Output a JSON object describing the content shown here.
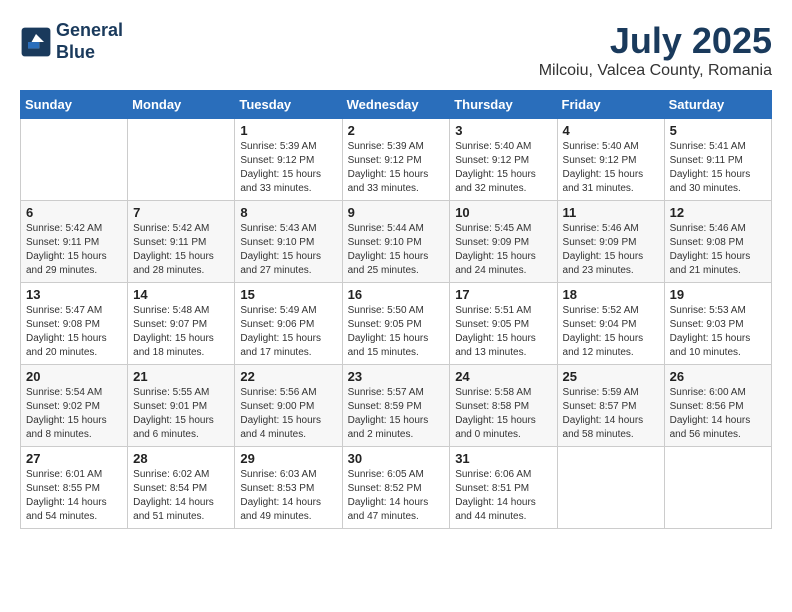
{
  "logo": {
    "line1": "General",
    "line2": "Blue"
  },
  "title": "July 2025",
  "location": "Milcoiu, Valcea County, Romania",
  "days_header": [
    "Sunday",
    "Monday",
    "Tuesday",
    "Wednesday",
    "Thursday",
    "Friday",
    "Saturday"
  ],
  "weeks": [
    [
      {
        "day": "",
        "sunrise": "",
        "sunset": "",
        "daylight": ""
      },
      {
        "day": "",
        "sunrise": "",
        "sunset": "",
        "daylight": ""
      },
      {
        "day": "1",
        "sunrise": "Sunrise: 5:39 AM",
        "sunset": "Sunset: 9:12 PM",
        "daylight": "Daylight: 15 hours and 33 minutes."
      },
      {
        "day": "2",
        "sunrise": "Sunrise: 5:39 AM",
        "sunset": "Sunset: 9:12 PM",
        "daylight": "Daylight: 15 hours and 33 minutes."
      },
      {
        "day": "3",
        "sunrise": "Sunrise: 5:40 AM",
        "sunset": "Sunset: 9:12 PM",
        "daylight": "Daylight: 15 hours and 32 minutes."
      },
      {
        "day": "4",
        "sunrise": "Sunrise: 5:40 AM",
        "sunset": "Sunset: 9:12 PM",
        "daylight": "Daylight: 15 hours and 31 minutes."
      },
      {
        "day": "5",
        "sunrise": "Sunrise: 5:41 AM",
        "sunset": "Sunset: 9:11 PM",
        "daylight": "Daylight: 15 hours and 30 minutes."
      }
    ],
    [
      {
        "day": "6",
        "sunrise": "Sunrise: 5:42 AM",
        "sunset": "Sunset: 9:11 PM",
        "daylight": "Daylight: 15 hours and 29 minutes."
      },
      {
        "day": "7",
        "sunrise": "Sunrise: 5:42 AM",
        "sunset": "Sunset: 9:11 PM",
        "daylight": "Daylight: 15 hours and 28 minutes."
      },
      {
        "day": "8",
        "sunrise": "Sunrise: 5:43 AM",
        "sunset": "Sunset: 9:10 PM",
        "daylight": "Daylight: 15 hours and 27 minutes."
      },
      {
        "day": "9",
        "sunrise": "Sunrise: 5:44 AM",
        "sunset": "Sunset: 9:10 PM",
        "daylight": "Daylight: 15 hours and 25 minutes."
      },
      {
        "day": "10",
        "sunrise": "Sunrise: 5:45 AM",
        "sunset": "Sunset: 9:09 PM",
        "daylight": "Daylight: 15 hours and 24 minutes."
      },
      {
        "day": "11",
        "sunrise": "Sunrise: 5:46 AM",
        "sunset": "Sunset: 9:09 PM",
        "daylight": "Daylight: 15 hours and 23 minutes."
      },
      {
        "day": "12",
        "sunrise": "Sunrise: 5:46 AM",
        "sunset": "Sunset: 9:08 PM",
        "daylight": "Daylight: 15 hours and 21 minutes."
      }
    ],
    [
      {
        "day": "13",
        "sunrise": "Sunrise: 5:47 AM",
        "sunset": "Sunset: 9:08 PM",
        "daylight": "Daylight: 15 hours and 20 minutes."
      },
      {
        "day": "14",
        "sunrise": "Sunrise: 5:48 AM",
        "sunset": "Sunset: 9:07 PM",
        "daylight": "Daylight: 15 hours and 18 minutes."
      },
      {
        "day": "15",
        "sunrise": "Sunrise: 5:49 AM",
        "sunset": "Sunset: 9:06 PM",
        "daylight": "Daylight: 15 hours and 17 minutes."
      },
      {
        "day": "16",
        "sunrise": "Sunrise: 5:50 AM",
        "sunset": "Sunset: 9:05 PM",
        "daylight": "Daylight: 15 hours and 15 minutes."
      },
      {
        "day": "17",
        "sunrise": "Sunrise: 5:51 AM",
        "sunset": "Sunset: 9:05 PM",
        "daylight": "Daylight: 15 hours and 13 minutes."
      },
      {
        "day": "18",
        "sunrise": "Sunrise: 5:52 AM",
        "sunset": "Sunset: 9:04 PM",
        "daylight": "Daylight: 15 hours and 12 minutes."
      },
      {
        "day": "19",
        "sunrise": "Sunrise: 5:53 AM",
        "sunset": "Sunset: 9:03 PM",
        "daylight": "Daylight: 15 hours and 10 minutes."
      }
    ],
    [
      {
        "day": "20",
        "sunrise": "Sunrise: 5:54 AM",
        "sunset": "Sunset: 9:02 PM",
        "daylight": "Daylight: 15 hours and 8 minutes."
      },
      {
        "day": "21",
        "sunrise": "Sunrise: 5:55 AM",
        "sunset": "Sunset: 9:01 PM",
        "daylight": "Daylight: 15 hours and 6 minutes."
      },
      {
        "day": "22",
        "sunrise": "Sunrise: 5:56 AM",
        "sunset": "Sunset: 9:00 PM",
        "daylight": "Daylight: 15 hours and 4 minutes."
      },
      {
        "day": "23",
        "sunrise": "Sunrise: 5:57 AM",
        "sunset": "Sunset: 8:59 PM",
        "daylight": "Daylight: 15 hours and 2 minutes."
      },
      {
        "day": "24",
        "sunrise": "Sunrise: 5:58 AM",
        "sunset": "Sunset: 8:58 PM",
        "daylight": "Daylight: 15 hours and 0 minutes."
      },
      {
        "day": "25",
        "sunrise": "Sunrise: 5:59 AM",
        "sunset": "Sunset: 8:57 PM",
        "daylight": "Daylight: 14 hours and 58 minutes."
      },
      {
        "day": "26",
        "sunrise": "Sunrise: 6:00 AM",
        "sunset": "Sunset: 8:56 PM",
        "daylight": "Daylight: 14 hours and 56 minutes."
      }
    ],
    [
      {
        "day": "27",
        "sunrise": "Sunrise: 6:01 AM",
        "sunset": "Sunset: 8:55 PM",
        "daylight": "Daylight: 14 hours and 54 minutes."
      },
      {
        "day": "28",
        "sunrise": "Sunrise: 6:02 AM",
        "sunset": "Sunset: 8:54 PM",
        "daylight": "Daylight: 14 hours and 51 minutes."
      },
      {
        "day": "29",
        "sunrise": "Sunrise: 6:03 AM",
        "sunset": "Sunset: 8:53 PM",
        "daylight": "Daylight: 14 hours and 49 minutes."
      },
      {
        "day": "30",
        "sunrise": "Sunrise: 6:05 AM",
        "sunset": "Sunset: 8:52 PM",
        "daylight": "Daylight: 14 hours and 47 minutes."
      },
      {
        "day": "31",
        "sunrise": "Sunrise: 6:06 AM",
        "sunset": "Sunset: 8:51 PM",
        "daylight": "Daylight: 14 hours and 44 minutes."
      },
      {
        "day": "",
        "sunrise": "",
        "sunset": "",
        "daylight": ""
      },
      {
        "day": "",
        "sunrise": "",
        "sunset": "",
        "daylight": ""
      }
    ]
  ]
}
